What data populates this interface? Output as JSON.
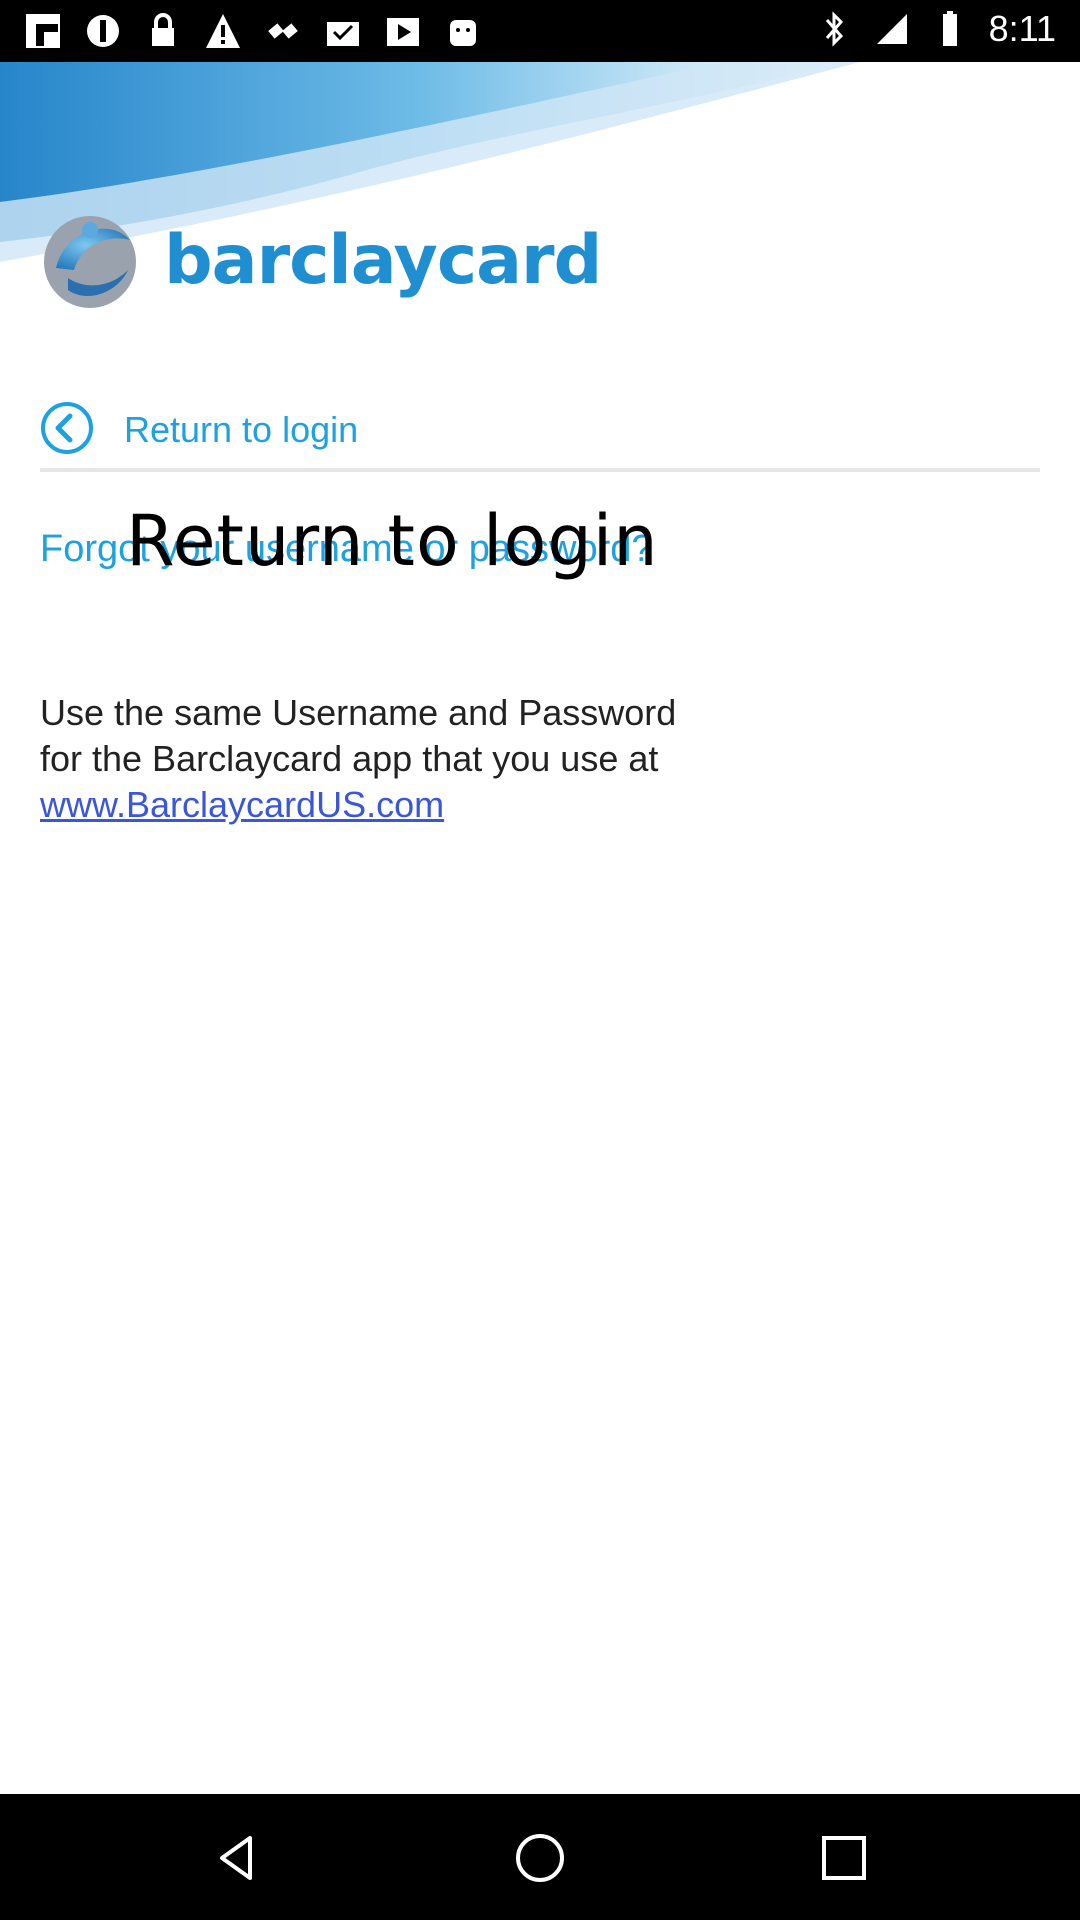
{
  "status_bar": {
    "time": "8:11",
    "left_icons": [
      "flipboard-icon",
      "settings-icon",
      "lock-icon",
      "warning-icon",
      "satellite-icon",
      "inbox-icon",
      "media-icon",
      "android-icon"
    ],
    "right_icons": [
      "bluetooth-icon",
      "signal-icon",
      "battery-icon"
    ]
  },
  "brand": {
    "name": "barclaycard"
  },
  "nav": {
    "return_label": "Return to login"
  },
  "forgot": {
    "label": "Forgot your username or password?"
  },
  "overlay": {
    "text": "Return to login"
  },
  "info": {
    "line1": "Use the same Username and Password",
    "line2": "for the Barclaycard app that you use at",
    "link": "www.BarclaycardUS.com"
  },
  "colors": {
    "accent": "#1da1e0",
    "link": "#3a56d9"
  }
}
